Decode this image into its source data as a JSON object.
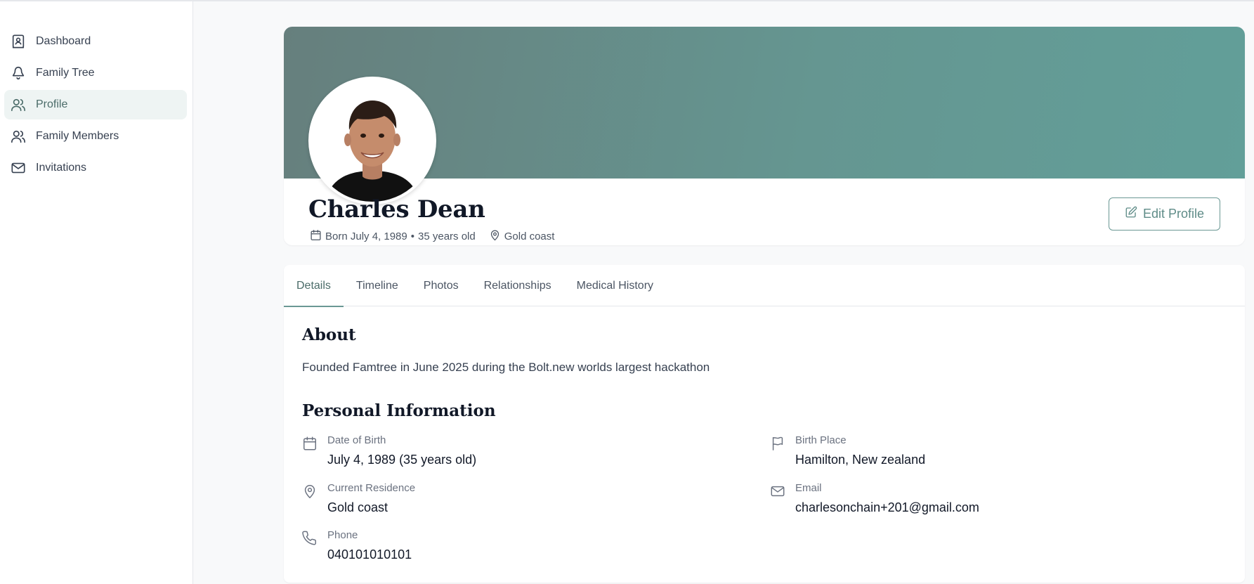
{
  "sidebar": {
    "items": [
      {
        "label": "Dashboard",
        "icon": "contact-book-icon",
        "active": false
      },
      {
        "label": "Family Tree",
        "icon": "tree-icon",
        "active": false
      },
      {
        "label": "Profile",
        "icon": "users-icon",
        "active": true
      },
      {
        "label": "Family Members",
        "icon": "users-icon",
        "active": false
      },
      {
        "label": "Invitations",
        "icon": "mail-icon",
        "active": false
      }
    ]
  },
  "profile": {
    "name": "Charles Dean",
    "born": "Born July 4, 1989",
    "separator": "•",
    "age": "35 years old",
    "location": "Gold coast",
    "edit_label": "Edit Profile"
  },
  "tabs": [
    {
      "label": "Details",
      "active": true
    },
    {
      "label": "Timeline",
      "active": false
    },
    {
      "label": "Photos",
      "active": false
    },
    {
      "label": "Relationships",
      "active": false
    },
    {
      "label": "Medical History",
      "active": false
    }
  ],
  "about": {
    "title": "About",
    "text": "Founded Famtree in June 2025 during the Bolt.new worlds largest hackathon"
  },
  "personal": {
    "title": "Personal Information",
    "dob": {
      "label": "Date of Birth",
      "value": "July 4, 1989 (35 years old)",
      "icon": "calendar-icon"
    },
    "birth_place": {
      "label": "Birth Place",
      "value": "Hamilton, New zealand",
      "icon": "flag-icon"
    },
    "residence": {
      "label": "Current Residence",
      "value": "Gold coast",
      "icon": "map-pin-icon"
    },
    "email": {
      "label": "Email",
      "value": "charlesonchain+201@gmail.com",
      "icon": "mail-icon"
    },
    "phone": {
      "label": "Phone",
      "value": "040101010101",
      "icon": "phone-icon"
    }
  },
  "colors": {
    "accent": "#6a9894",
    "cover_start": "#667f7d",
    "cover_end": "#629f99",
    "active_nav_bg": "#eef4f3"
  }
}
